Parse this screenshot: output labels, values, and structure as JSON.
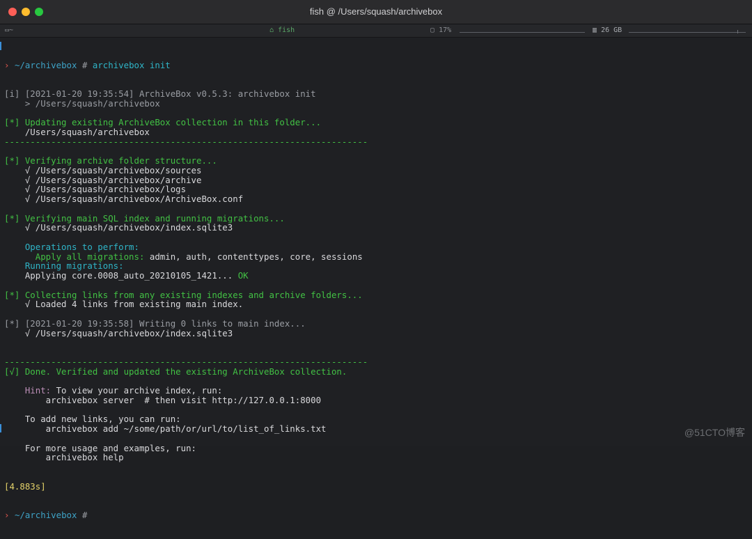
{
  "window": {
    "title": "fish  @  /Users/squash/archivebox"
  },
  "statusbar": {
    "folder": "~",
    "shell": "fish",
    "cpu": "17%",
    "disk": "26 GB"
  },
  "terminal": {
    "prompt_path": "~/archivebox",
    "prompt_symbol": "#",
    "command": "archivebox init",
    "lines": [
      {
        "kind": "info",
        "text": "[i] [2021-01-20 19:35:54] ArchiveBox v0.5.3: archivebox init"
      },
      {
        "kind": "info",
        "text": "    > /Users/squash/archivebox"
      },
      {
        "kind": "blank",
        "text": ""
      },
      {
        "kind": "green",
        "text": "[*] Updating existing ArchiveBox collection in this folder..."
      },
      {
        "kind": "plain",
        "text": "    /Users/squash/archivebox"
      },
      {
        "kind": "green",
        "text": "----------------------------------------------------------------------"
      },
      {
        "kind": "blank",
        "text": ""
      },
      {
        "kind": "green",
        "text": "[*] Verifying archive folder structure..."
      },
      {
        "kind": "plain",
        "text": "    √ /Users/squash/archivebox/sources"
      },
      {
        "kind": "plain",
        "text": "    √ /Users/squash/archivebox/archive"
      },
      {
        "kind": "plain",
        "text": "    √ /Users/squash/archivebox/logs"
      },
      {
        "kind": "plain",
        "text": "    √ /Users/squash/archivebox/ArchiveBox.conf"
      },
      {
        "kind": "blank",
        "text": ""
      },
      {
        "kind": "green",
        "text": "[*] Verifying main SQL index and running migrations..."
      },
      {
        "kind": "plain",
        "text": "    √ /Users/squash/archivebox/index.sqlite3"
      },
      {
        "kind": "blank",
        "text": ""
      },
      {
        "kind": "cyan",
        "text": "    Operations to perform:"
      },
      {
        "kind": "split",
        "a": "      Apply all migrations:",
        "b": " admin, auth, contenttypes, core, sessions"
      },
      {
        "kind": "cyan",
        "text": "    Running migrations:"
      },
      {
        "kind": "ok",
        "a": "    Applying core.0008_auto_20210105_1421...",
        "b": " OK"
      },
      {
        "kind": "blank",
        "text": ""
      },
      {
        "kind": "green",
        "text": "[*] Collecting links from any existing indexes and archive folders..."
      },
      {
        "kind": "plain",
        "text": "    √ Loaded 4 links from existing main index."
      },
      {
        "kind": "blank",
        "text": ""
      },
      {
        "kind": "info",
        "text": "[*] [2021-01-20 19:35:58] Writing 0 links to main index..."
      },
      {
        "kind": "plain",
        "text": "    √ /Users/squash/archivebox/index.sqlite3"
      },
      {
        "kind": "blank",
        "text": ""
      },
      {
        "kind": "blank",
        "text": ""
      },
      {
        "kind": "green",
        "text": "----------------------------------------------------------------------"
      },
      {
        "kind": "green",
        "text": "[√] Done. Verified and updated the existing ArchiveBox collection."
      },
      {
        "kind": "blank",
        "text": ""
      },
      {
        "kind": "hint",
        "a": "    Hint:",
        "b": " To view your archive index, run:"
      },
      {
        "kind": "plain",
        "text": "        archivebox server  # then visit http://127.0.0.1:8000"
      },
      {
        "kind": "blank",
        "text": ""
      },
      {
        "kind": "plain",
        "text": "    To add new links, you can run:"
      },
      {
        "kind": "plain",
        "text": "        archivebox add ~/some/path/or/url/to/list_of_links.txt"
      },
      {
        "kind": "blank",
        "text": ""
      },
      {
        "kind": "plain",
        "text": "    For more usage and examples, run:"
      },
      {
        "kind": "plain",
        "text": "        archivebox help"
      }
    ],
    "duration": "[4.883s]",
    "final_prompt_path": "~/archivebox",
    "final_prompt_symbol": "#"
  },
  "watermark": "@51CTO博客"
}
